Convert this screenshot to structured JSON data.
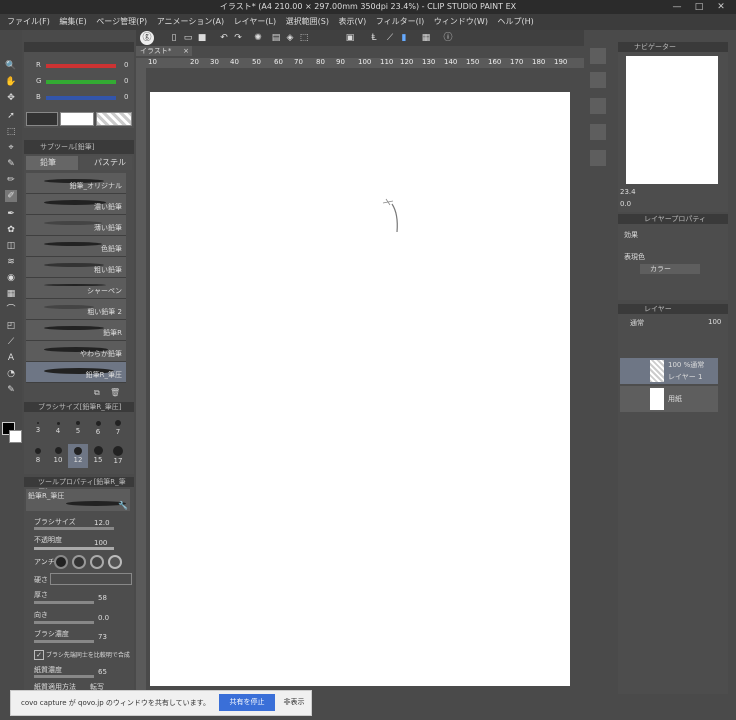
{
  "window": {
    "title": "イラスト* (A4 210.00 × 297.00mm 350dpi 23.4%) - CLIP STUDIO PAINT EX",
    "minimize": "—",
    "maximize": "□",
    "close": "✕"
  },
  "menu": [
    "ファイル(F)",
    "編集(E)",
    "ページ管理(P)",
    "アニメーション(A)",
    "レイヤー(L)",
    "選択範囲(S)",
    "表示(V)",
    "フィルター(I)",
    "ウィンドウ(W)",
    "ヘルプ(H)"
  ],
  "color_sliders": {
    "r": "R",
    "g": "G",
    "b": "B",
    "r_value": "0",
    "g_value": "0",
    "b_value": "0"
  },
  "subtool": {
    "header": "サブツール[鉛筆]",
    "tabs": [
      "鉛筆",
      "パステル"
    ],
    "brushes": [
      "鉛筆_オリジナル",
      "濃い鉛筆",
      "薄い鉛筆",
      "色鉛筆",
      "粗い鉛筆",
      "シャーペン",
      "粗い鉛筆 2",
      "鉛筆R",
      "やわらか鉛筆",
      "鉛筆R_筆圧"
    ]
  },
  "brush_size": {
    "header": "ブラシサイズ[鉛筆R_筆圧]",
    "row1": [
      "3",
      "4",
      "5",
      "6",
      "7"
    ],
    "row2": [
      "8",
      "10",
      "12",
      "15",
      "17"
    ]
  },
  "tool_property": {
    "header": "ツールプロパティ[鉛筆R_筆圧]",
    "name": "鉛筆R_筆圧",
    "props": [
      {
        "label": "ブラシサイズ",
        "value": "12.0"
      },
      {
        "label": "不透明度",
        "value": "100"
      },
      {
        "label": "アンチ",
        "value": ""
      },
      {
        "label": "硬さ",
        "value": ""
      },
      {
        "label": "厚さ",
        "value": "58"
      },
      {
        "label": "向き",
        "value": "0.0"
      },
      {
        "label": "ブラシ濃度",
        "value": "73"
      }
    ],
    "check_label": "ブラシ先端同士を比較明で合成",
    "texture_label": "紙質濃度",
    "texture_value": "65",
    "texture_method": "紙質適用方法",
    "texture_method_value": "転写"
  },
  "canvas_tab": {
    "label": "イラスト*",
    "close": "×"
  },
  "ruler_marks": [
    "10",
    "20",
    "30",
    "40",
    "50",
    "60",
    "70",
    "80",
    "90",
    "100",
    "110",
    "120",
    "130",
    "140",
    "150",
    "160",
    "170",
    "180",
    "190"
  ],
  "v_ruler_marks": [
    "10",
    "20",
    "30",
    "40",
    "50",
    "60",
    "70",
    "80",
    "90",
    "100",
    "110",
    "120",
    "130",
    "140",
    "150",
    "160",
    "170",
    "180",
    "190",
    "200",
    "210",
    "220",
    "230",
    "240",
    "250",
    "260",
    "270",
    "280",
    "290"
  ],
  "navigator": {
    "header": "ナビゲーター",
    "zoom": "23.4",
    "angle": "0.0"
  },
  "layer_property": {
    "header": "レイヤープロパティ",
    "effect_label": "効果",
    "color_label": "表現色",
    "color_value": "カラー"
  },
  "layers_panel": {
    "header": "レイヤー",
    "blend": "通常",
    "opacity": "100",
    "layers": [
      {
        "pct": "100 %通常",
        "name": "レイヤー 1"
      },
      {
        "pct": "",
        "name": "用紙"
      }
    ]
  },
  "share_bar": {
    "text": "covo capture が qovo.jp のウィンドウを共有しています。",
    "stop": "共有を停止",
    "hide": "非表示"
  },
  "colors": {
    "main": "#000000",
    "sub": "#ffffff",
    "accent_button": "#3a6fd8"
  }
}
